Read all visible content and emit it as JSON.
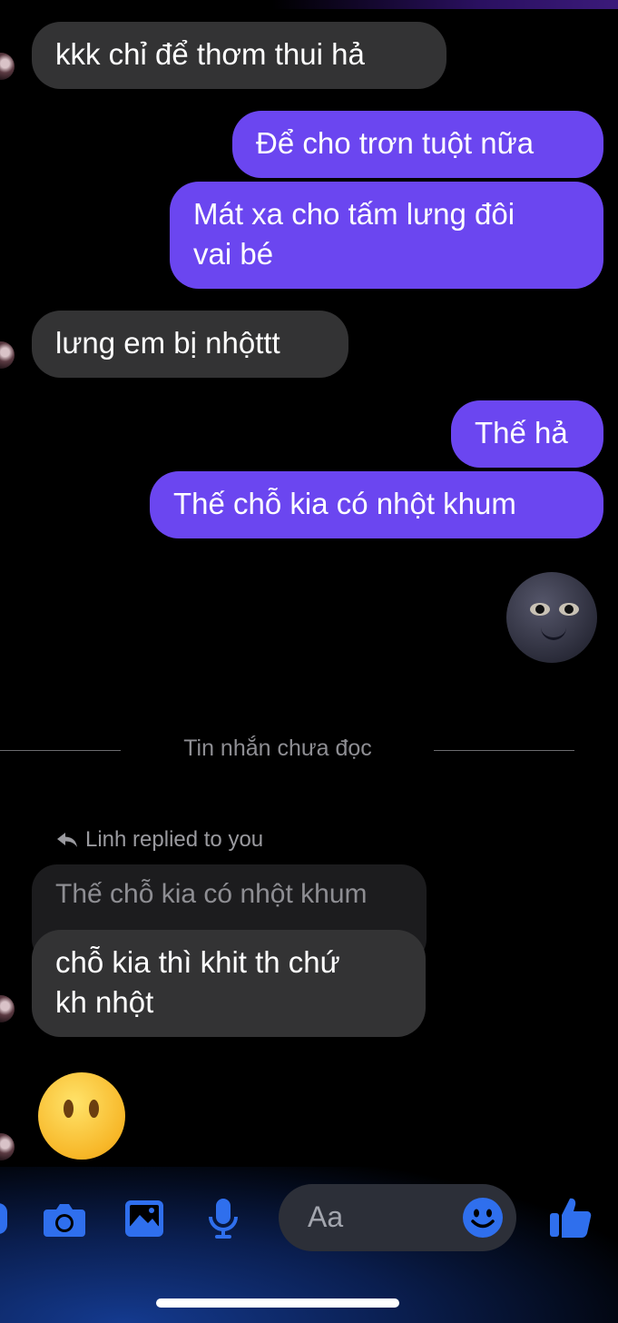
{
  "messages": [
    {
      "id": "m1",
      "text": "kkk chỉ để thơm thui hả"
    },
    {
      "id": "m2",
      "text": "Để cho trơn tuột nữa"
    },
    {
      "id": "m3",
      "line1": "Mát xa cho tấm lưng đôi",
      "line2": "vai bé"
    },
    {
      "id": "m4",
      "text": "lưng em bị nhộttt"
    },
    {
      "id": "m5",
      "text": "Thế hả"
    },
    {
      "id": "m6",
      "text": "Thế chỗ kia có nhột khum"
    },
    {
      "id": "m7",
      "line1": "chỗ kia thì khit th chứ",
      "line2": "kh nhột"
    }
  ],
  "unread_divider": "Tin nhắn chưa đọc",
  "reply": {
    "hint": "Linh replied to you",
    "quoted_text": "Thế chỗ kia có nhột khum"
  },
  "emojis": {
    "sent": "new-moon-face",
    "received": "face-without-mouth"
  },
  "composer": {
    "placeholder": "Aa"
  },
  "icons": {
    "camera": "camera-icon",
    "gallery": "image-icon",
    "voice": "microphone-icon",
    "emoji": "emoji-icon",
    "like": "thumbs-up-icon"
  },
  "colors": {
    "outgoing_bubble": "#6b46f0",
    "incoming_bubble": "#333334",
    "accent": "#2f6fed"
  }
}
